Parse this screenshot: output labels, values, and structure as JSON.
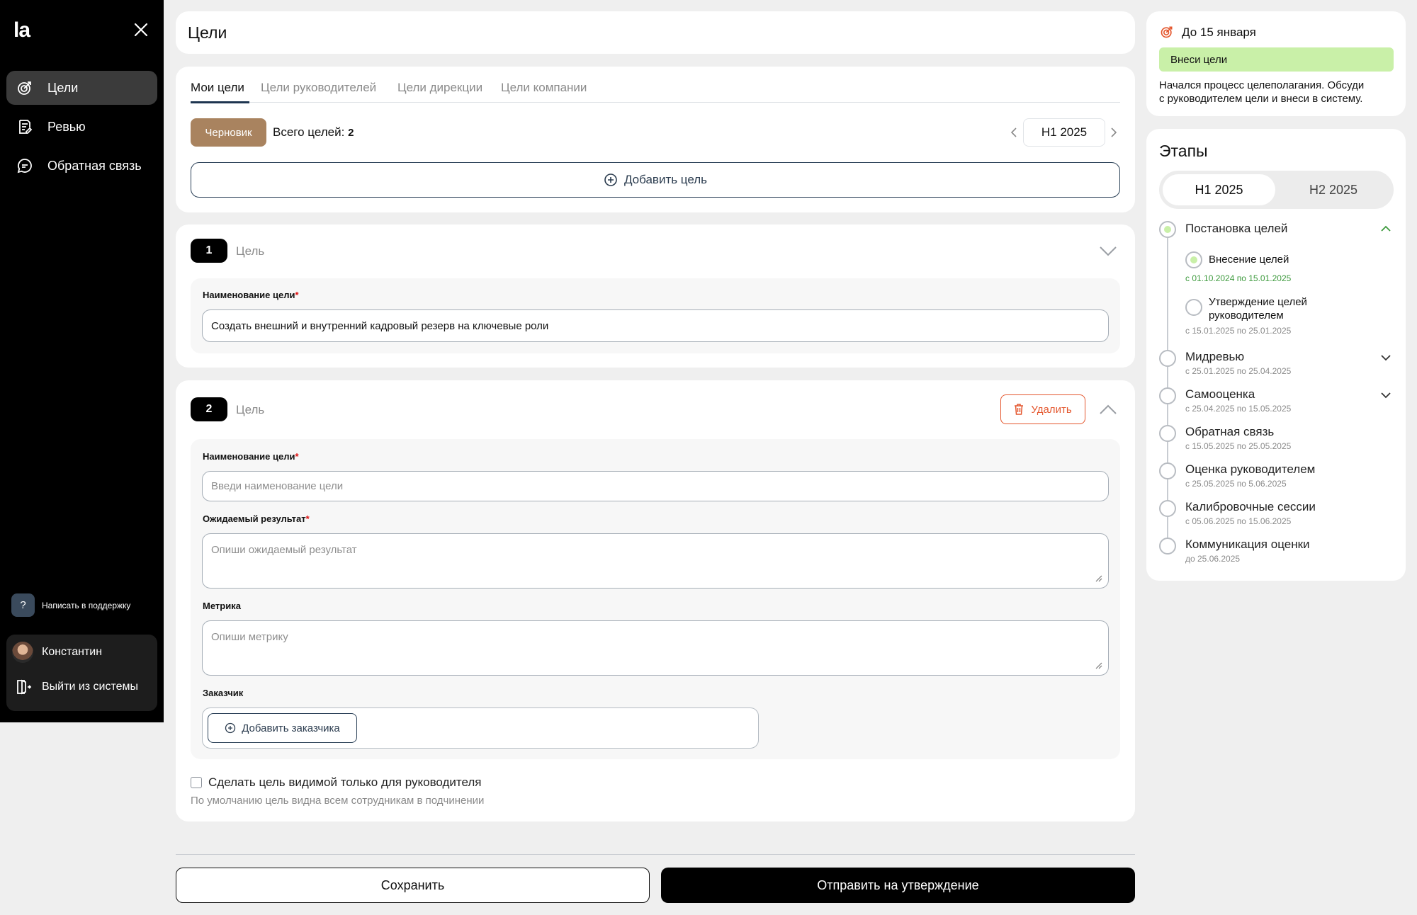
{
  "sidebar": {
    "logo": "la",
    "items": [
      {
        "label": "Цели",
        "icon": "target-icon"
      },
      {
        "label": "Ревью",
        "icon": "document-edit-icon"
      },
      {
        "label": "Обратная связь",
        "icon": "chat-icon"
      }
    ],
    "support_label": "Написать в поддержку",
    "support_icon_text": "?",
    "user_name": "Константин",
    "logout_label": "Выйти из системы"
  },
  "header": {
    "title": "Цели"
  },
  "tabs": [
    "Мои цели",
    "Цели руководителей",
    "Цели дирекции",
    "Цели компании"
  ],
  "status_chip": "Черновик",
  "total_label": "Всего целей:",
  "total_count": "2",
  "period": "H1 2025",
  "add_goal_label": "Добавить цель",
  "goal1": {
    "number": "1",
    "label": "Цель",
    "name_label": "Наименование цели",
    "required_mark": "*",
    "name_value": "Создать внешний и внутренний кадровый резерв на ключевые роли"
  },
  "goal2": {
    "number": "2",
    "label": "Цель",
    "delete_label": "Удалить",
    "name_label": "Наименование цели",
    "name_placeholder": "Введи наименование цели",
    "result_label": "Ожидаемый результат",
    "result_placeholder": "Опиши ожидаемый результат",
    "metric_label": "Метрика",
    "metric_placeholder": "Опиши метрику",
    "customer_label": "Заказчик",
    "add_customer_label": "Добавить заказчика",
    "required_mark": "*"
  },
  "visibility": {
    "checkbox_label": "Сделать цель видимой только для руководителя",
    "hint": "По умолчанию цель видна всем сотрудникам в подчинении",
    "checked": false
  },
  "footer": {
    "save_label": "Сохранить",
    "submit_label": "Отправить на утверждение"
  },
  "deadline": {
    "title": "До 15 января",
    "banner": "Внеси цели",
    "text_line1": "Начался процесс целеполагания. Обсуди",
    "text_line2": "с руководителем цели и внеси в систему."
  },
  "stages": {
    "title": "Этапы",
    "periods": [
      "H1 2025",
      "H2 2025"
    ],
    "active_period": "H1 2025",
    "list": [
      {
        "name": "Постановка целей",
        "date": "",
        "expanded": true
      },
      {
        "name": "Мидревью",
        "date": "с 25.01.2025 по 25.04.2025"
      },
      {
        "name": "Самооценка",
        "date": "с 25.04.2025 по 15.05.2025"
      },
      {
        "name": "Обратная связь",
        "date": "с 15.05.2025 по 25.05.2025"
      },
      {
        "name": "Оценка руководителем",
        "date": "с 25.05.2025 по 5.06.2025"
      },
      {
        "name": "Калибровочные сессии",
        "date": "с 05.06.2025 по 15.06.2025"
      },
      {
        "name": "Коммуникация оценки",
        "date": "до 25.06.2025"
      }
    ],
    "substeps": [
      {
        "name": "Внесение целей",
        "date": "с 01.10.2024 по 15.01.2025",
        "active": true
      },
      {
        "name_line1": "Утверждение целей",
        "name_line2": "руководителем",
        "date": "с 15.01.2025 по 25.01.2025"
      }
    ]
  },
  "colors": {
    "accent_green": "#3d9a3d",
    "chip_brown": "#a9835f",
    "delete_orange": "#e4572e",
    "banner_green": "#c9f0a8"
  }
}
